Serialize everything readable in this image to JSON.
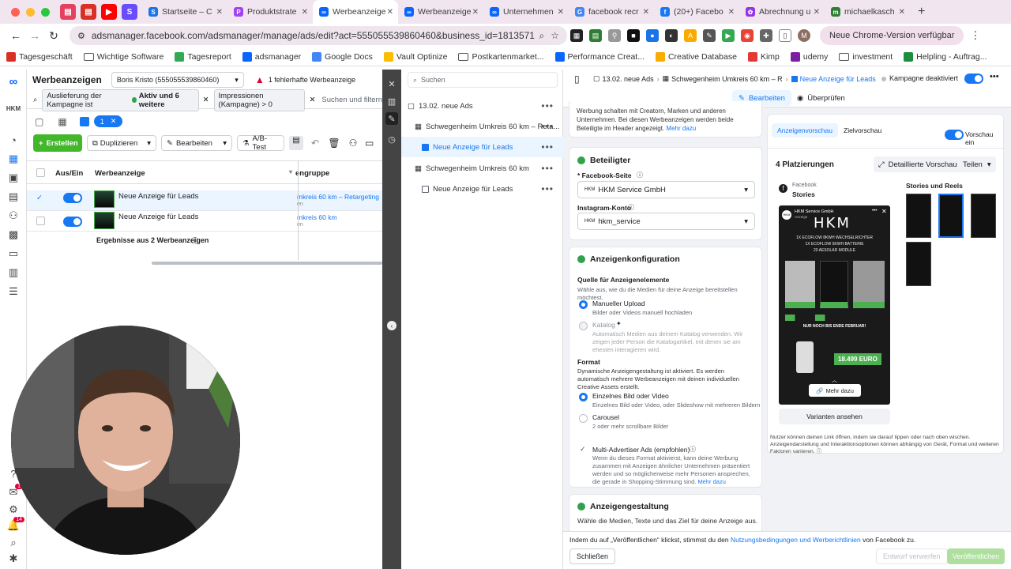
{
  "browser": {
    "tabs": [
      {
        "label": "Startseite – C",
        "color": "#1a73e8",
        "letter": "S"
      },
      {
        "label": "Produktstrate",
        "color": "#a142f4",
        "letter": "P"
      },
      {
        "label": "Werbeanzeige",
        "color": "#0866ff",
        "letter": "∞",
        "active": true
      },
      {
        "label": "Werbeanzeige",
        "color": "#0866ff",
        "letter": "∞"
      },
      {
        "label": "Unternehmen",
        "color": "#0866ff",
        "letter": "∞"
      },
      {
        "label": "facebook recr",
        "color": "#4285f4",
        "letter": "G"
      },
      {
        "label": "(20+) Facebo",
        "color": "#1877f2",
        "letter": "f"
      },
      {
        "label": "Abrechnung u",
        "color": "#9334e6",
        "letter": "✿"
      },
      {
        "label": "michaelkasch",
        "color": "#2e7d32",
        "letter": "m"
      }
    ],
    "url": "adsmanager.facebook.com/adsmanager/manage/ads/edit?act=555055539860460&business_id=181357131234...",
    "update_button": "Neue Chrome-Version verfügbar",
    "bookmarks": [
      "Tagesgeschäft",
      "Wichtige Software",
      "Tagesreport",
      "adsmanager",
      "Google Docs",
      "Vault Optinize",
      "Postkartenmarket...",
      "Performance Creat...",
      "Creative Database",
      "Kimp",
      "udemy",
      "investment",
      "Helpling - Auftrag..."
    ]
  },
  "main": {
    "title": "Werbeanzeigen",
    "account": "Boris Kristo (555055539860460)",
    "error": "1 fehlerhafte Werbeanzeige",
    "filter_delivery": "Auslieferung der Kampagne ist",
    "filter_delivery_value": "Aktiv und 6 weitere",
    "filter_impr": "Impressionen (Kampagne) > 0",
    "search_placeholder": "Suchen und filtern",
    "selected_count": "1",
    "toolbar": {
      "create": "Erstellen",
      "duplicate": "Duplizieren",
      "edit": "Bearbeiten",
      "ab": "A/B-Test"
    },
    "columns": {
      "onoff": "Aus/Ein",
      "ad": "Werbeanzeige",
      "adset": "engruppe"
    },
    "rows": [
      {
        "name": "Neue Anzeige für Leads",
        "adset": "mkreis 60 km – Retargeting",
        "sub": "en"
      },
      {
        "name": "Neue Anzeige für Leads",
        "adset": "mkreis 60 km",
        "sub": "en"
      }
    ],
    "results": "Ergebnisse aus 2 Werbeanzeigen"
  },
  "tree": {
    "search_placeholder": "Suchen",
    "campaign": "13.02. neue Ads",
    "items": [
      {
        "label": "Schwegenheim Umkreis 60 km – Reta..."
      },
      {
        "label": "Neue Anzeige für Leads"
      },
      {
        "label": "Schwegenheim Umkreis 60 km"
      },
      {
        "label": "Neue Anzeige für Leads"
      }
    ]
  },
  "editor": {
    "breadcrumb": [
      "13.02. neue Ads",
      "Schwegenheim Umkreis 60 km – R",
      "Neue Anzeige für Leads"
    ],
    "campaign_status": "Kampagne deaktiviert",
    "tab_edit": "Bearbeiten",
    "tab_review": "Überprüfen",
    "intro": "Werbung schalten mit Creatorn, Marken und anderen Unternehmen. Bei diesen Werbeanzeigen werden beide Beteiligte im Header angezeigt.",
    "more": "Mehr dazu",
    "identity": {
      "title": "Beteiligter",
      "fb_label": "* Facebook-Seite",
      "fb_value": "HKM Service GmbH",
      "ig_label": "Instagram-Konto",
      "ig_value": "hkm_service"
    },
    "config": {
      "title": "Anzeigenkonfiguration",
      "source_title": "Quelle für Anzeigenelemente",
      "source_desc": "Wähle aus, wie du die Medien für deine Anzeige bereitstellen möchtest.",
      "manual": "Manueller Upload",
      "manual_desc": "Bilder oder Videos manuell hochladen",
      "catalog": "Katalog",
      "catalog_desc": "Automatisch Medien aus deinem Katalog verwenden. Wir zeigen jeder Person die Katalogartikel, mit denen sie am ehesten interagieren wird.",
      "format_title": "Format",
      "format_desc": "Dynamische Anzeigengestaltung ist aktiviert. Es werden automatisch mehrere Werbeanzeigen mit deinen individuellen Creative Assets erstellt.",
      "single": "Einzelnes Bild oder Video",
      "single_desc": "Einzelnes Bild oder Video, oder Slideshow mit mehreren Bildern",
      "carousel": "Carousel",
      "carousel_desc": "2 oder mehr scrollbare Bilder",
      "multi": "Multi-Advertiser Ads (empfohlen)",
      "multi_desc": "Wenn du dieses Format aktivierst, kann deine Werbung zusammen mit Anzeigen ähnlicher Unternehmen präsentiert werden und so möglicherweise mehr Personen ansprechen, die gerade in Shopping-Stimmung sind.",
      "multi_more": "Mehr dazu"
    },
    "design": {
      "title": "Anzeigengestaltung",
      "desc": "Wähle die Medien, Texte und das Ziel für deine Anzeige aus."
    },
    "preview": {
      "tab_ad": "Anzeigenvorschau",
      "tab_target": "Zielvorschau",
      "preview_on": "Vorschau ein",
      "placements": "4 Platzierungen",
      "detail": "Detaillierte Vorschau",
      "share": "Teilen",
      "platform": "Facebook",
      "placement": "Stories",
      "stories_reels": "Stories und Reels",
      "page_name": "HKM Service GmbH",
      "sponsored": "Anzeige",
      "brand": "HKM",
      "headline1": "1X ECOFLOW 8KWH WECHSELRICHTER",
      "headline2": "1X ECOFLOW 5KWH BATTERIE",
      "headline3": "20 AESOLAR MODULE",
      "offer": "NUR NOCH BIS ENDE FEBRUAR!",
      "price": "18.499 EURO",
      "cta": "Mehr dazu",
      "variants": "Varianten ansehen",
      "note": "Nutzer können deinen Link öffnen, indem sie darauf tippen oder nach oben wischen. Anzeigendarstellung und Interaktionsoptionen können abhängig von Gerät, Format und weiteren Faktoren variieren."
    },
    "footer": {
      "terms_pre": "Indem du auf „Veröffentlichen“ klickst, stimmst du den",
      "terms_link": "Nutzungsbedingungen und Werberichtlinien",
      "terms_post": "von Facebook zu.",
      "close": "Schließen",
      "draft": "Entwurf verwerfen",
      "publish": "Veröffentlichen"
    }
  },
  "rail_badges": {
    "notifications": "1",
    "alerts": "14"
  },
  "colors": {
    "accent": "#1877f2",
    "success": "#31a24c",
    "create": "#42b72a",
    "error": "#e4003a"
  }
}
